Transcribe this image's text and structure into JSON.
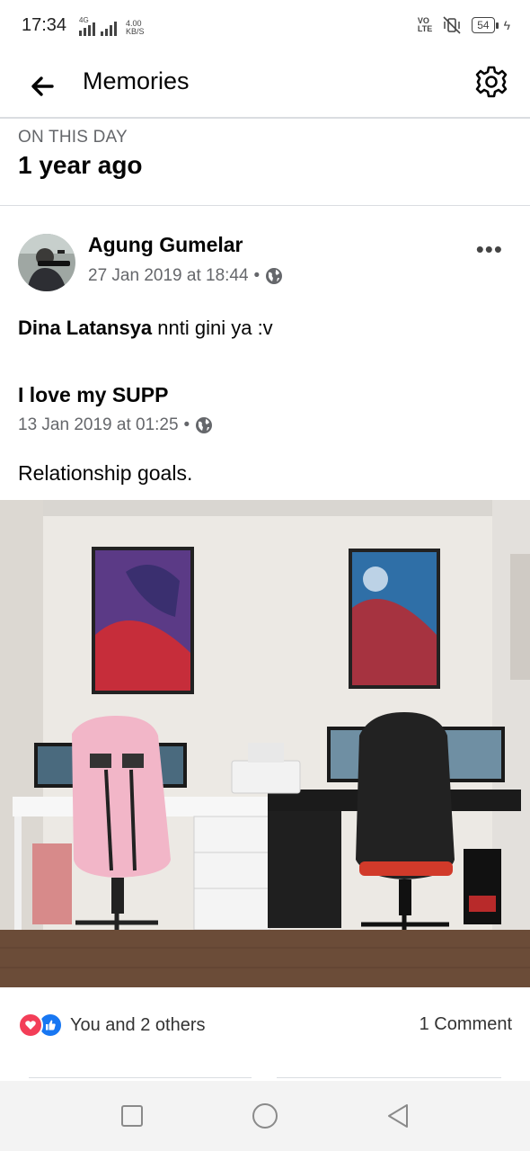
{
  "status_bar": {
    "time": "17:34",
    "network_tag": "4G",
    "speed_value": "4.00",
    "speed_unit": "KB/S",
    "volte_top": "VO",
    "volte_bottom": "LTE",
    "battery": "54"
  },
  "header": {
    "title": "Memories"
  },
  "section": {
    "label": "ON THIS DAY",
    "title": "1 year ago"
  },
  "post": {
    "author": "Agung Gumelar",
    "timestamp": "27 Jan 2019 at 18:44",
    "separator": "•",
    "mention": "Dina Latansya",
    "text": " nnti gini ya :v",
    "shared": {
      "title": "I love my SUPP",
      "timestamp": "13 Jan 2019 at 01:25",
      "text": "Relationship goals."
    },
    "reactions_text": "You and 2 others",
    "comments_text": "1 Comment"
  },
  "colors": {
    "like_blue": "#1877f2",
    "love_red": "#f33e58",
    "secondary_text": "#65676b"
  },
  "icons": [
    "back-arrow-icon",
    "gear-icon",
    "more-dots-icon",
    "globe-icon",
    "love-reaction-icon",
    "like-reaction-icon",
    "square-icon",
    "circle-icon",
    "triangle-back-icon"
  ]
}
